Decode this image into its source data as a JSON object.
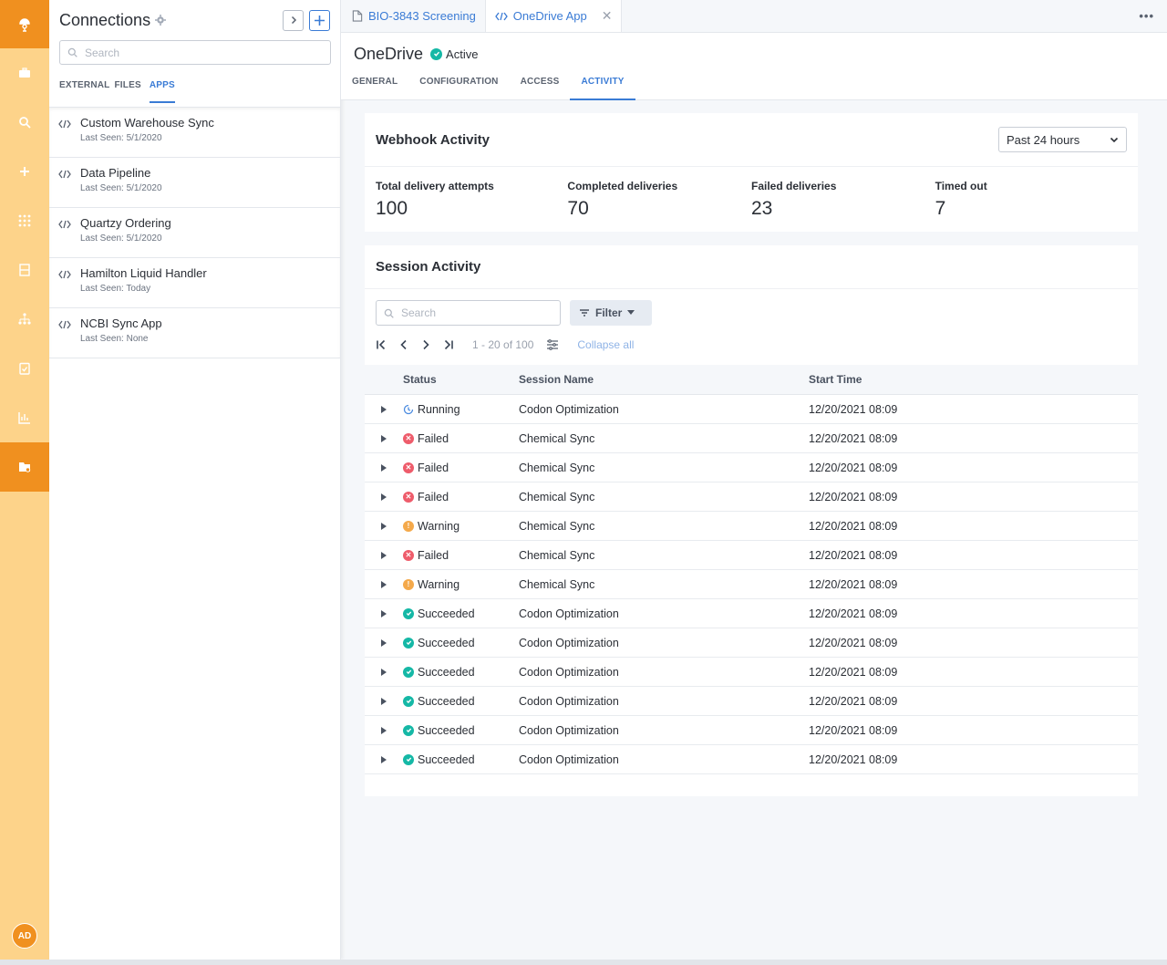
{
  "rail": {
    "items": [
      {
        "name": "briefcase-icon"
      },
      {
        "name": "search-icon"
      },
      {
        "name": "plus-icon"
      },
      {
        "name": "grid-icon"
      },
      {
        "name": "inventory-icon"
      },
      {
        "name": "hierarchy-icon"
      },
      {
        "name": "clipboard-check-icon"
      },
      {
        "name": "chart-icon"
      },
      {
        "name": "folder-settings-icon",
        "active": true
      }
    ],
    "avatar": "AD"
  },
  "panel": {
    "title": "Connections",
    "search_placeholder": "Search",
    "tabs": [
      "EXTERNAL",
      "FILES",
      "APPS"
    ],
    "active_tab": "APPS",
    "apps": [
      {
        "name": "Custom Warehouse Sync",
        "last_seen": "Last Seen: 5/1/2020"
      },
      {
        "name": "Data Pipeline",
        "last_seen": "Last Seen: 5/1/2020"
      },
      {
        "name": "Quartzy Ordering",
        "last_seen": "Last Seen: 5/1/2020"
      },
      {
        "name": "Hamilton Liquid Handler",
        "last_seen": "Last Seen: Today"
      },
      {
        "name": "NCBI Sync App",
        "last_seen": "Last Seen: None"
      }
    ]
  },
  "tabs": {
    "doc1": "BIO-3843 Screening",
    "doc2": "OneDrive App"
  },
  "header": {
    "title": "OneDrive",
    "status": "Active",
    "subtabs": [
      "GENERAL",
      "CONFIGURATION",
      "ACCESS",
      "ACTIVITY"
    ]
  },
  "webhook": {
    "title": "Webhook Activity",
    "range": "Past 24 hours",
    "stats": [
      {
        "label": "Total delivery attempts",
        "value": "100"
      },
      {
        "label": "Completed deliveries",
        "value": "70"
      },
      {
        "label": "Failed deliveries",
        "value": "23"
      },
      {
        "label": "Timed out",
        "value": "7"
      }
    ]
  },
  "session": {
    "title": "Session Activity",
    "search_placeholder": "Search",
    "filter_label": "Filter",
    "range": "1 - 20 of 100",
    "collapse_label": "Collapse all",
    "columns": {
      "status": "Status",
      "name": "Session Name",
      "time": "Start Time"
    },
    "rows": [
      {
        "status": "Running",
        "kind": "running",
        "name": "Codon Optimization",
        "time": "12/20/2021 08:09"
      },
      {
        "status": "Failed",
        "kind": "failed",
        "name": "Chemical Sync",
        "time": "12/20/2021 08:09"
      },
      {
        "status": "Failed",
        "kind": "failed",
        "name": "Chemical Sync",
        "time": "12/20/2021 08:09"
      },
      {
        "status": "Failed",
        "kind": "failed",
        "name": "Chemical Sync",
        "time": "12/20/2021 08:09"
      },
      {
        "status": "Warning",
        "kind": "warning",
        "name": "Chemical Sync",
        "time": "12/20/2021 08:09"
      },
      {
        "status": "Failed",
        "kind": "failed",
        "name": "Chemical Sync",
        "time": "12/20/2021 08:09"
      },
      {
        "status": "Warning",
        "kind": "warning",
        "name": "Chemical Sync",
        "time": "12/20/2021 08:09"
      },
      {
        "status": "Succeeded",
        "kind": "succeeded",
        "name": "Codon Optimization",
        "time": "12/20/2021 08:09"
      },
      {
        "status": "Succeeded",
        "kind": "succeeded",
        "name": "Codon Optimization",
        "time": "12/20/2021 08:09"
      },
      {
        "status": "Succeeded",
        "kind": "succeeded",
        "name": "Codon Optimization",
        "time": "12/20/2021 08:09"
      },
      {
        "status": "Succeeded",
        "kind": "succeeded",
        "name": "Codon Optimization",
        "time": "12/20/2021 08:09"
      },
      {
        "status": "Succeeded",
        "kind": "succeeded",
        "name": "Codon Optimization",
        "time": "12/20/2021 08:09"
      },
      {
        "status": "Succeeded",
        "kind": "succeeded",
        "name": "Codon Optimization",
        "time": "12/20/2021 08:09"
      }
    ]
  },
  "colors": {
    "accent": "#3a7bd5",
    "brand": "#f0901f",
    "rail": "#fdd38a",
    "success": "#15b8a6",
    "danger": "#ee5c6b",
    "warning": "#f4a94b"
  }
}
